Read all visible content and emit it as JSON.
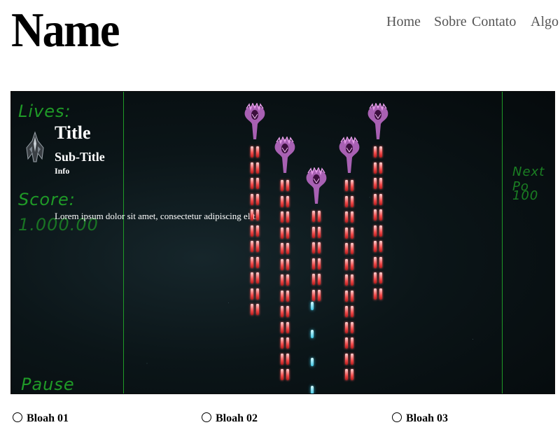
{
  "header": {
    "site_name": "Name"
  },
  "nav": {
    "items": [
      "Home",
      "Sobre",
      "Contato",
      "Algo"
    ]
  },
  "game": {
    "lives_label": "Lives:",
    "score_label": "Score:",
    "score_value": "1.000.00",
    "pause_label": "Pause",
    "next_label": "Next Po",
    "next_value": "100",
    "info_card": {
      "title": "Title",
      "subtitle": "Sub-Title",
      "info": "Info",
      "description": "Lorem ipsum dolor sit amet, consectetur adipiscing elit."
    },
    "colors": {
      "hud": "#1f9a27",
      "enemy": "#c46fcf",
      "enemy_bullet": "#f24a4a",
      "player_bullet": "#3ec6e3"
    },
    "enemies": {
      "count": 5,
      "icon": "alien-ship-icon"
    },
    "player_ship_icon": "player-ship-icon"
  },
  "footer": {
    "items": [
      "Bloah 01",
      "Bloah 02",
      "Bloah 03"
    ]
  }
}
